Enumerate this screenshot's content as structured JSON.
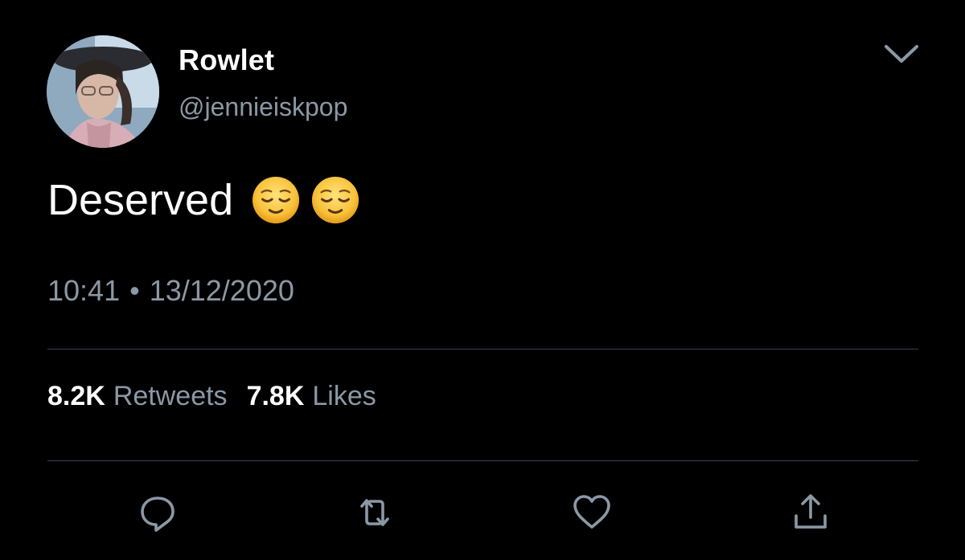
{
  "author": {
    "display_name": "Rowlet",
    "handle": "@jennieiskpop"
  },
  "tweet": {
    "text": "Deserved",
    "emojis": [
      "relieved-face-emoji",
      "relieved-face-emoji"
    ],
    "time": "10:41",
    "separator": "•",
    "date": "13/12/2020"
  },
  "stats": {
    "retweets_count": "8.2K",
    "retweets_label": "Retweets",
    "likes_count": "7.8K",
    "likes_label": "Likes"
  },
  "actions": [
    "reply-icon",
    "retweet-icon",
    "like-icon",
    "share-icon"
  ],
  "colors": {
    "background": "#000000",
    "primary_text": "#ffffff",
    "secondary_text": "#8b98a5",
    "divider": "#38444d",
    "emoji_yellow": "#f7c23b"
  }
}
